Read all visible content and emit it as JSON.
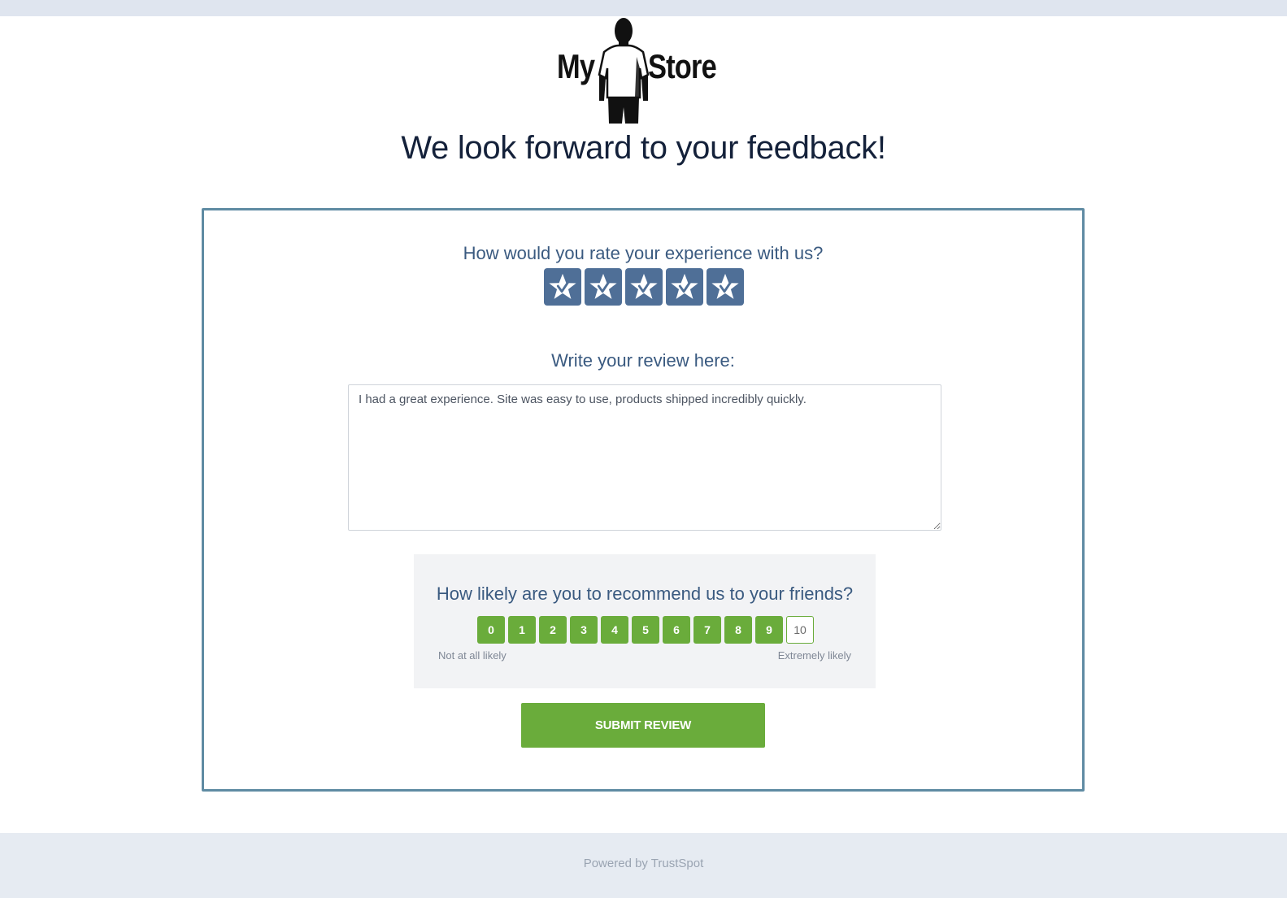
{
  "logo": {
    "word_left": "My",
    "word_right": "Store"
  },
  "page_title": "We look forward to your feedback!",
  "rating": {
    "question": "How would you rate your experience with us?",
    "selected_stars": 5,
    "max_stars": 5,
    "star_color": "#4f6f97",
    "icon": "star-icon"
  },
  "review": {
    "label": "Write your review here:",
    "value": "I had a great experience. Site was easy to use, products shipped incredibly quickly."
  },
  "nps": {
    "question": "How likely are you to recommend us to your friends?",
    "options": [
      "0",
      "1",
      "2",
      "3",
      "4",
      "5",
      "6",
      "7",
      "8",
      "9",
      "10"
    ],
    "selected": "10",
    "low_label": "Not at all likely",
    "high_label": "Extremely likely",
    "accent_color": "#6aac3b"
  },
  "submit": {
    "label": "SUBMIT REVIEW"
  },
  "footer": {
    "text": "Powered by TrustSpot"
  },
  "colors": {
    "card_border": "#5f8ba3",
    "top_strip": "#dfe5ef",
    "footer_bg": "#e6ebf2"
  }
}
